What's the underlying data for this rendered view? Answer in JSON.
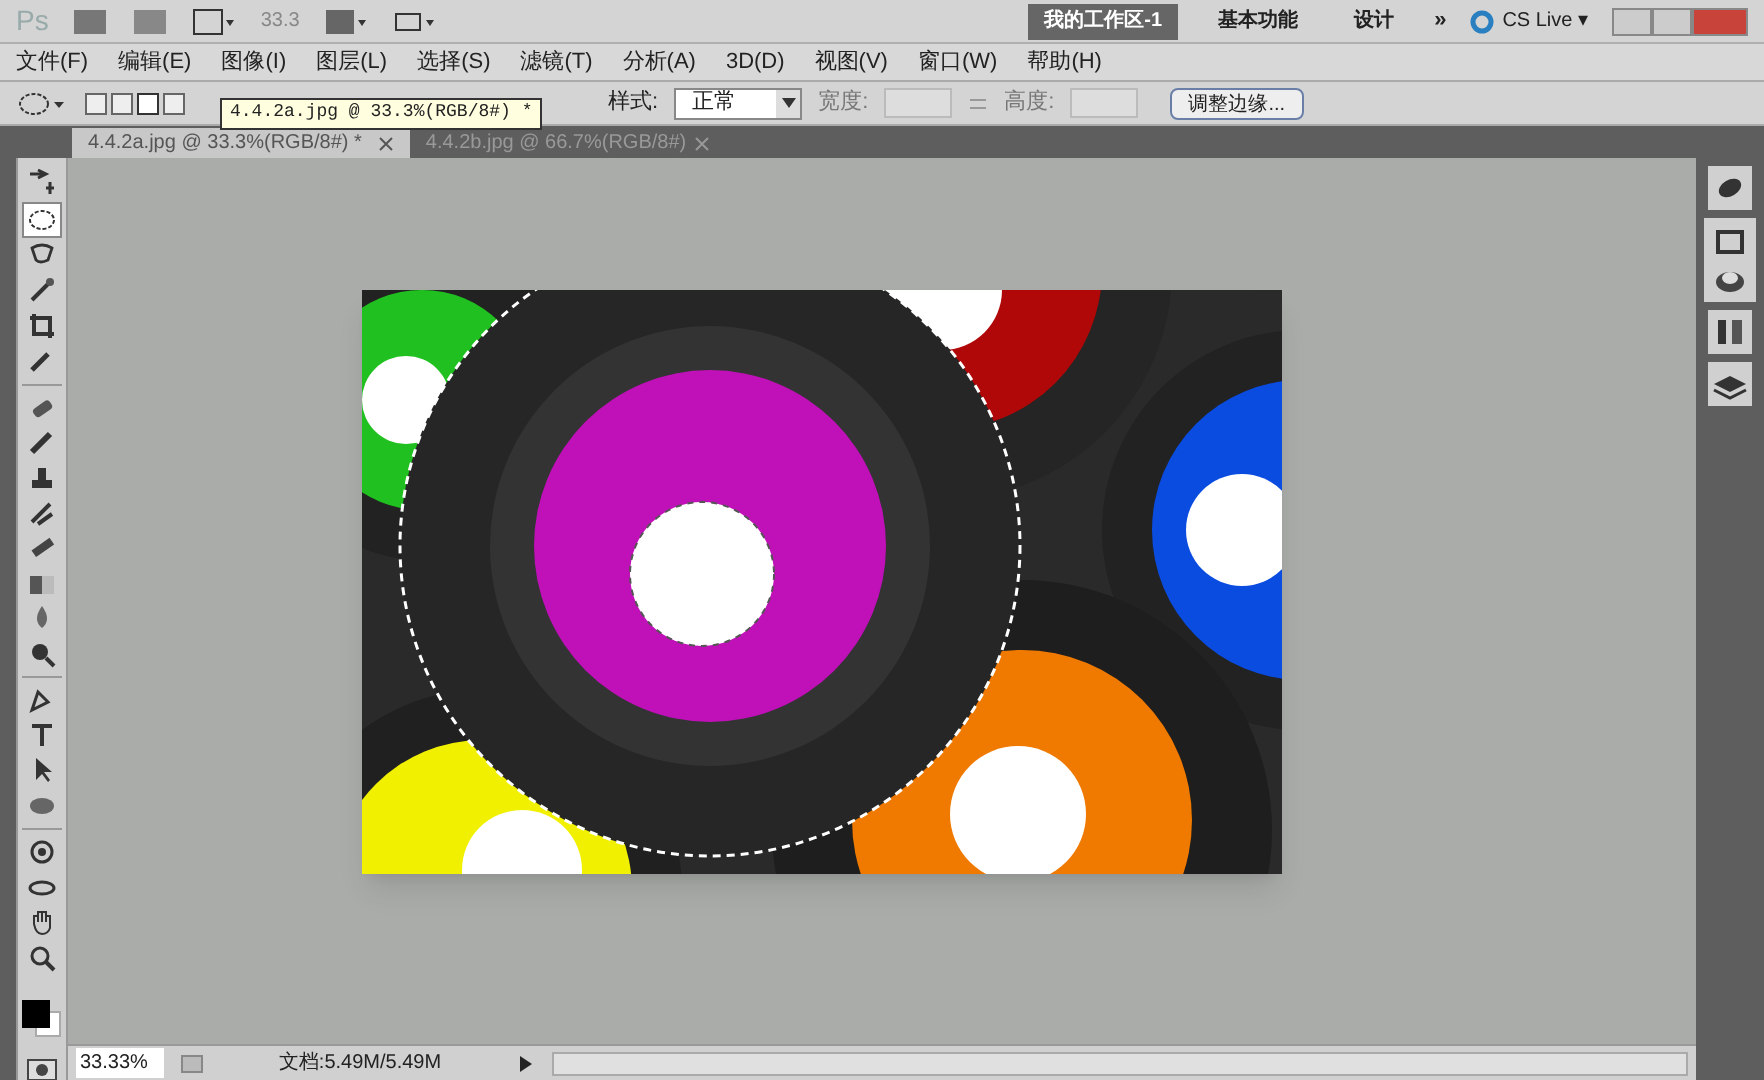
{
  "app_bar": {
    "logo": "Ps",
    "zoom": "33.3",
    "workspaces": [
      {
        "label": "我的工作区-1",
        "selected": true
      },
      {
        "label": "基本功能",
        "selected": false
      },
      {
        "label": "设计",
        "selected": false
      }
    ],
    "more": "»",
    "cs_live": "CS Live",
    "cs_live_caret": "▾"
  },
  "menu": [
    "文件(F)",
    "编辑(E)",
    "图像(I)",
    "图层(L)",
    "选择(S)",
    "滤镜(T)",
    "分析(A)",
    "3D(D)",
    "视图(V)",
    "窗口(W)",
    "帮助(H)"
  ],
  "options": {
    "style_label": "样式:",
    "style_value": "正常",
    "width_label": "宽度:",
    "height_label": "高度:",
    "refine_button": "调整边缘..."
  },
  "tooltip": "4.4.2a.jpg @ 33.3%(RGB/8#) *",
  "tabs": [
    {
      "label": "4.4.2a.jpg @ 33.3%(RGB/8#) *",
      "selected": true
    },
    {
      "label": "4.4.2b.jpg @ 66.7%(RGB/8#)",
      "selected": false
    }
  ],
  "tools": [
    {
      "kind": "move",
      "selected": false
    },
    {
      "kind": "marquee",
      "selected": true
    },
    {
      "kind": "lasso",
      "selected": false
    },
    {
      "kind": "wand",
      "selected": false
    },
    {
      "kind": "crop",
      "selected": false
    },
    {
      "kind": "eyedropper",
      "selected": false
    },
    {
      "kind": "heal",
      "selected": false
    },
    {
      "kind": "brush",
      "selected": false
    },
    {
      "kind": "stamp",
      "selected": false
    },
    {
      "kind": "history",
      "selected": false
    },
    {
      "kind": "eraser",
      "selected": false
    },
    {
      "kind": "gradient",
      "selected": false
    },
    {
      "kind": "blur",
      "selected": false
    },
    {
      "kind": "dodge",
      "selected": false
    },
    {
      "kind": "pen",
      "selected": false
    },
    {
      "kind": "type",
      "selected": false
    },
    {
      "kind": "select",
      "selected": false
    },
    {
      "kind": "shape",
      "selected": false
    },
    {
      "kind": "rotate",
      "selected": false
    },
    {
      "kind": "orbit",
      "selected": false
    },
    {
      "kind": "hand",
      "selected": false
    },
    {
      "kind": "zoom",
      "selected": false
    }
  ],
  "status_bar": {
    "zoom": "33.33%",
    "document": "文档:5.49M/5.49M"
  }
}
